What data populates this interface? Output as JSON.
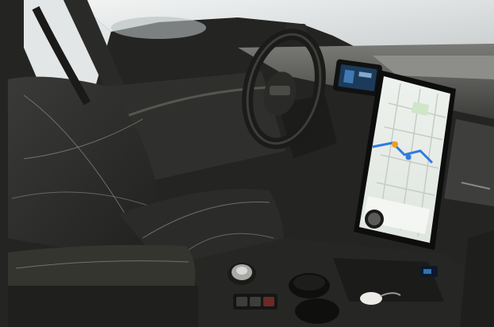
{
  "scene": {
    "subject": "car-interior",
    "elements": [
      "driver-seat",
      "steering-wheel",
      "instrument-cluster",
      "center-touchscreen",
      "navigation-map",
      "volume-knob",
      "gear-selector-dial",
      "center-console",
      "cupholders",
      "key-fob"
    ]
  },
  "colors": {
    "upholstery": "#2d2e2b",
    "stitching": "#8a8a83",
    "trim": "#3a3b38",
    "dashboard": "#5c5d5a",
    "window": "#d9dcdc",
    "map_background": "#e8ece8",
    "map_route": "#2f7be0"
  }
}
